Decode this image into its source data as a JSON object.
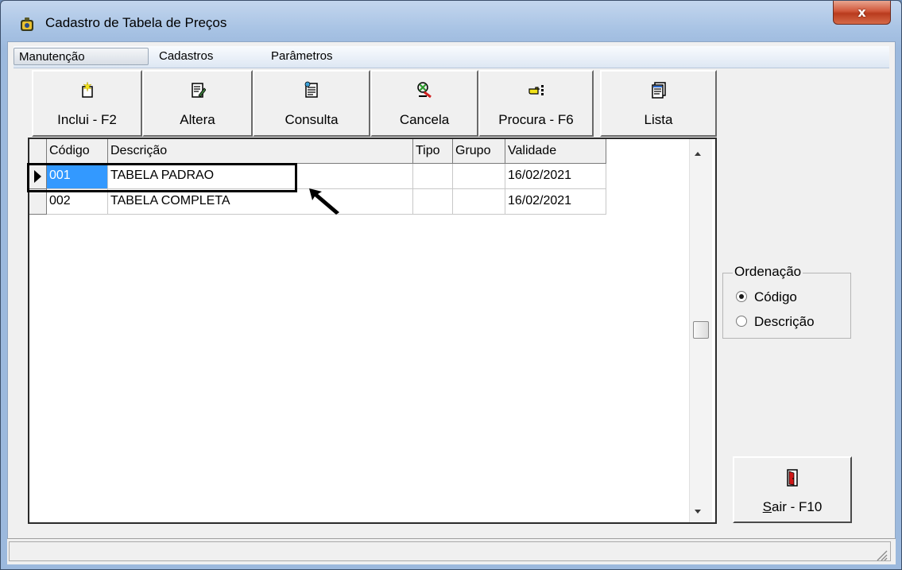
{
  "window": {
    "title": "Cadastro de Tabela de Preços",
    "close_label": "x"
  },
  "menu": {
    "items": [
      {
        "label": "Manutenção",
        "active": true
      },
      {
        "label": "Cadastros",
        "active": false
      },
      {
        "label": "Parâmetros",
        "active": false
      }
    ]
  },
  "toolbar": {
    "buttons": [
      {
        "label": "Inclui - F2",
        "icon": "new-document-icon"
      },
      {
        "label": "Altera",
        "icon": "edit-document-icon"
      },
      {
        "label": "Consulta",
        "icon": "view-document-icon"
      },
      {
        "label": "Cancela",
        "icon": "cancel-icon"
      },
      {
        "label": "Procura - F6",
        "icon": "search-pointer-icon"
      },
      {
        "label": "Lista",
        "icon": "list-document-icon"
      }
    ]
  },
  "grid": {
    "columns": [
      "Código",
      "Descrição",
      "Tipo",
      "Grupo",
      "Validade"
    ],
    "rows": [
      {
        "codigo": "001",
        "descricao": "TABELA PADRAO",
        "tipo": "",
        "grupo": "",
        "validade": "16/02/2021",
        "selected": true
      },
      {
        "codigo": "002",
        "descricao": "TABELA COMPLETA",
        "tipo": "",
        "grupo": "",
        "validade": "16/02/2021",
        "selected": false
      }
    ]
  },
  "ordenacao": {
    "legend": "Ordenação",
    "options": [
      {
        "label": "Código",
        "checked": true
      },
      {
        "label": "Descrição",
        "checked": false
      }
    ]
  },
  "exit_button": {
    "label": "Sair - F10",
    "icon": "exit-door-icon"
  },
  "colors": {
    "selection": "#3399ff",
    "title_gradient": "#a8c3e4",
    "close_button": "#c7452a"
  }
}
